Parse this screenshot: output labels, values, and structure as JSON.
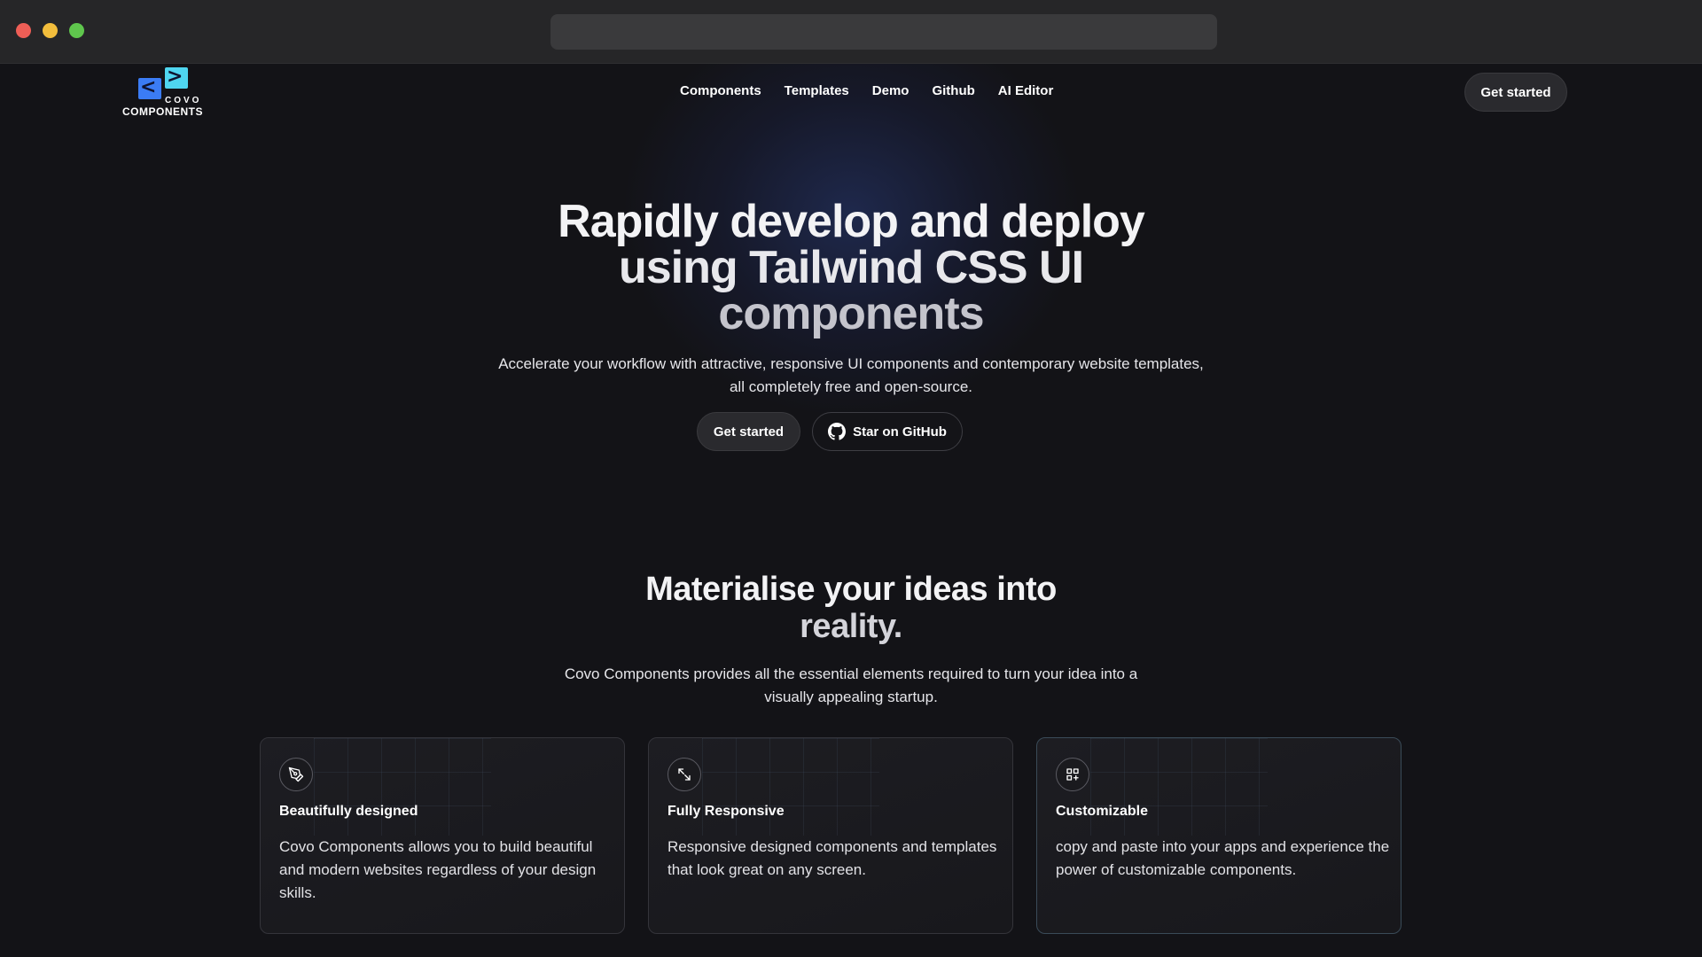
{
  "nav": {
    "logo_top": "COVO",
    "logo_bottom": "COMPONENTS",
    "links": [
      "Components",
      "Templates",
      "Demo",
      "Github",
      "AI Editor"
    ],
    "cta": "Get started"
  },
  "hero": {
    "title_line1": "Rapidly develop and deploy",
    "title_line2": "using Tailwind CSS UI",
    "title_line3": "components",
    "subtitle": "Accelerate your workflow with attractive, responsive UI components and contemporary website templates, all completely free and open-source.",
    "primary_button": "Get started",
    "secondary_button": "Star on GitHub"
  },
  "features": {
    "title_line1": "Materialise your ideas into",
    "title_line2": "reality.",
    "subtitle": "Covo Components provides all the essential elements required to turn your idea into a visually appealing startup.",
    "cards": [
      {
        "icon": "pen-tool-icon",
        "title": "Beautifully designed",
        "text": "Covo Components allows you to build beautiful and modern websites regardless of your design skills."
      },
      {
        "icon": "expand-icon",
        "title": "Fully Responsive",
        "text": "Responsive designed components and templates that look great on any screen."
      },
      {
        "icon": "grid-plus-icon",
        "title": "Customizable",
        "text": "copy and paste into your apps and experience the power of customizable components."
      }
    ]
  },
  "colors": {
    "background": "#131317",
    "accent_blue": "#3b7cf5",
    "accent_cyan": "#4fd6f0"
  }
}
